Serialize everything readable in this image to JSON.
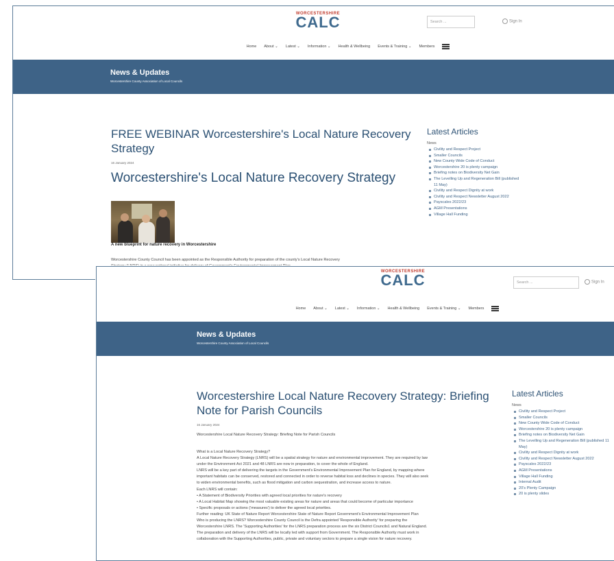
{
  "site": {
    "logo_small": "WORCESTERSHIRE",
    "logo_big": "CALC",
    "search_placeholder": "Search ...",
    "sign_in": "Sign In",
    "nav": [
      "Home",
      "About ⌄",
      "Latest ⌄",
      "Information ⌄",
      "Health & Wellbeing",
      "Events & Training ⌄",
      "Members"
    ],
    "banner_title": "News & Updates",
    "banner_subtitle": "Worcestershire County Association of Local Councils"
  },
  "article1": {
    "title": "FREE WEBINAR Worcestershire's Local Nature Recovery Strategy",
    "date": "16 January 2024",
    "heading": "Worcestershire's Local Nature Recovery Strategy",
    "image_alt": "People in a meeting",
    "caption": "A new blueprint for nature recovery in Worcestershire",
    "body_line1": "Worcestershire County Council has been appointed as the Responsible Authority for preparation of the county's Local Nature Recovery",
    "body_line2": "Strategy (LNRS) in a new national initiative for delivery of Government's Environmental Improvement Plan."
  },
  "article2": {
    "title": "Worcestershire Local Nature Recovery Strategy: Briefing Note for Parish Councils",
    "date": "16 January 2024",
    "intro": "Worcestershire Local Nature Recovery Strategy: Briefing Note for Parish Councils",
    "lines": [
      "What is a Local Nature Recovery Strategy?",
      "A Local Nature Recovery Strategy (LNRS) will be a spatial strategy for nature and environmental improvement. They are required by law",
      "under the Environment Act 2021 and 48 LNRS are now in preparation, to cover the whole of England.",
      "LNRS will be a key part of delivering the targets in the Government's Environmental Improvement Plan for England, by mapping where",
      "important habitats can be conserved, restored and connected in order to reverse habitat loss and declines in species. They will also seek",
      "to widen environmental benefits, such as flood mitigation and carbon sequestration, and increase access to nature.",
      "Each LNRS will contain:",
      "• A Statement of Biodiversity Priorities with agreed local priorities for nature's recovery",
      "• A Local Habitat Map showing the most valuable existing areas for nature and areas that could become of particular importance",
      "• Specific proposals or actions ('measures') to deliver the agreed local priorities.",
      "Further reading: UK State of Nature Report Worcestershire State of Nature Report Government's Environmental Improvement Plan",
      "Who is producing the LNRS? Worcestershire County Council is the Defra appointed 'Responsible Authority' for preparing the",
      "Worcestershire LNRS. The 'Supporting Authorities' for the LNRS preparation process are the six District Councils1 and Natural England.",
      "The preparation and delivery of the LNRS will be locally led with support from Government. The Responsible Authority must work in",
      "collaboration with the Supporting Authorities, public, private and voluntary sectors to prepare a single vision for nature recovery."
    ]
  },
  "latest": {
    "title": "Latest Articles",
    "category": "News",
    "items1": [
      "Civility and Respect Project",
      "Smaller Councils",
      "New County Wide Code of Conduct",
      "Worcestershire 20 is plenty campaign",
      "Briefing notes on Biodiversity Net Gain",
      "The Levelling Up and Regeneration Bill (published 11 May)",
      "Civility and Respect Dignity at work",
      "Civility and Respect Newsletter August 2022",
      "Payscales 2022/23",
      "AGM Presentations",
      "Village Hall Funding"
    ],
    "items2": [
      "Civility and Respect Project",
      "Smaller Councils",
      "New County Wide Code of Conduct",
      "Worcestershire 20 is plenty campaign",
      "Briefing notes on Biodiversity Net Gain",
      "The Levelling Up and Regeneration Bill (published 11 May)",
      "Civility and Respect Dignity at work",
      "Civility and Respect Newsletter August 2022",
      "Payscales 2022/23",
      "AGM Presentations",
      "Village Hall Funding",
      "Internal Audit",
      "20's Plenty Campaign",
      "20 is plenty slides"
    ]
  }
}
